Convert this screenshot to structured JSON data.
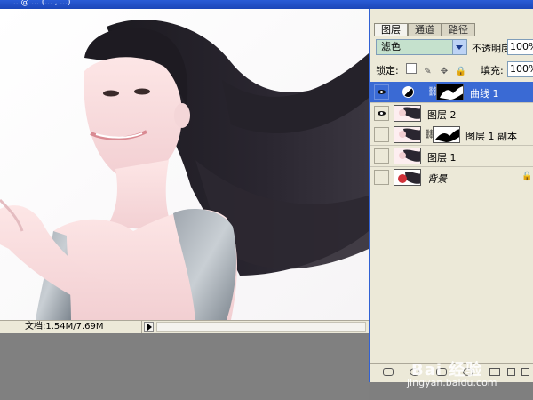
{
  "window": {
    "title": "... @ ... (... , ...)"
  },
  "status": {
    "doc_label": "文档:1.54M/7.69M"
  },
  "panel": {
    "tabs": [
      {
        "label": "图层",
        "active": true
      },
      {
        "label": "通道",
        "active": false
      },
      {
        "label": "路径",
        "active": false
      }
    ],
    "blend_mode": "滤色",
    "opacity_label": "不透明度:",
    "opacity_value": "100%",
    "lock_label": "锁定:",
    "fill_label": "填充:",
    "fill_value": "100%",
    "layers": [
      {
        "name": "曲线 1",
        "visible": true,
        "selected": true,
        "has_mask": true,
        "adjustment": true
      },
      {
        "name": "图层 2",
        "visible": true,
        "selected": false,
        "has_mask": false
      },
      {
        "name": "图层 1 副本",
        "visible": false,
        "selected": false,
        "has_mask": true
      },
      {
        "name": "图层 1",
        "visible": false,
        "selected": false,
        "has_mask": false
      },
      {
        "name": "背景",
        "visible": false,
        "selected": false,
        "has_mask": false,
        "locked": true
      }
    ]
  },
  "watermark": {
    "text": "Bai 经验",
    "url": "jingyan.baidu.com"
  },
  "colors": {
    "accent": "#3a6ad4",
    "panel_bg": "#ece9d8",
    "blend_bg": "#c5e1cd"
  }
}
